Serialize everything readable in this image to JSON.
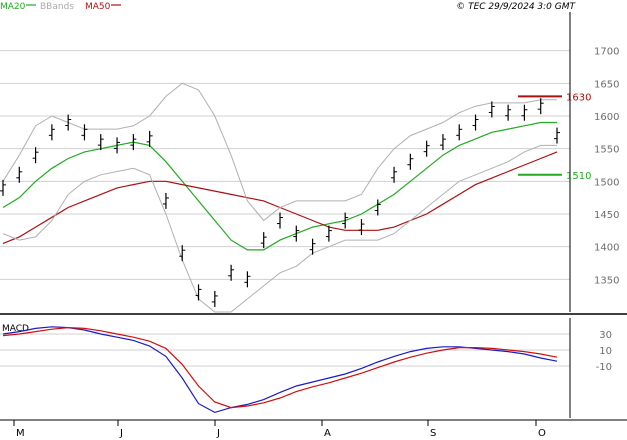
{
  "header": {
    "legend": [
      {
        "label": "MA20",
        "color": "#22aa22"
      },
      {
        "label": "BBands",
        "color": "#aaaaaa"
      },
      {
        "label": "MA50",
        "color": "#aa1111"
      }
    ],
    "copyright": "© TEC 29/9/2024 3:0 GMT"
  },
  "colors": {
    "grid": "#d0d0d0",
    "frame": "#000000",
    "ma20": "#22aa22",
    "ma50": "#aa1111",
    "bb": "#b0b0b0",
    "price": "#000000",
    "macd": "#1a1ac8",
    "signal": "#d01010",
    "tick_label": "#6d6d6d"
  },
  "chart_data": [
    {
      "type": "line",
      "title": "",
      "x": [
        "M",
        "J",
        "J",
        "A",
        "S",
        "O"
      ],
      "ylim": [
        1300,
        1750
      ],
      "y_ticks": [
        "1700",
        "1650",
        "1600",
        "1550",
        "1500",
        "1450",
        "1400",
        "1350"
      ],
      "series": [
        {
          "name": "MA20",
          "color": "#22aa22",
          "values": [
            1460,
            1475,
            1500,
            1520,
            1535,
            1545,
            1550,
            1555,
            1560,
            1555,
            1530,
            1500,
            1470,
            1440,
            1410,
            1395,
            1395,
            1410,
            1420,
            1430,
            1435,
            1440,
            1450,
            1465,
            1480,
            1500,
            1520,
            1540,
            1555,
            1565,
            1575,
            1580,
            1585,
            1590,
            1590
          ]
        },
        {
          "name": "MA50",
          "color": "#aa1111",
          "values": [
            1405,
            1415,
            1430,
            1445,
            1460,
            1470,
            1480,
            1490,
            1495,
            1500,
            1500,
            1495,
            1490,
            1485,
            1480,
            1475,
            1470,
            1460,
            1450,
            1440,
            1430,
            1425,
            1425,
            1425,
            1430,
            1440,
            1450,
            1465,
            1480,
            1495,
            1505,
            1515,
            1525,
            1535,
            1545
          ]
        },
        {
          "name": "BBands upper",
          "color": "#aaaaaa",
          "values": [
            1500,
            1540,
            1585,
            1600,
            1590,
            1580,
            1580,
            1580,
            1585,
            1600,
            1630,
            1650,
            1640,
            1600,
            1540,
            1470,
            1440,
            1460,
            1470,
            1470,
            1470,
            1470,
            1480,
            1520,
            1550,
            1570,
            1580,
            1590,
            1605,
            1615,
            1620,
            1620,
            1620,
            1625,
            1625
          ]
        },
        {
          "name": "BBands lower",
          "color": "#aaaaaa",
          "values": [
            1420,
            1410,
            1415,
            1440,
            1480,
            1500,
            1510,
            1515,
            1520,
            1510,
            1450,
            1380,
            1320,
            1300,
            1300,
            1320,
            1340,
            1360,
            1370,
            1390,
            1400,
            1410,
            1410,
            1410,
            1420,
            1440,
            1460,
            1480,
            1500,
            1510,
            1520,
            1530,
            1545,
            1555,
            1555
          ]
        },
        {
          "name": "Price",
          "color": "#000000",
          "values": [
            1490,
            1510,
            1540,
            1575,
            1590,
            1575,
            1560,
            1555,
            1560,
            1565,
            1470,
            1390,
            1330,
            1320,
            1360,
            1350,
            1410,
            1440,
            1420,
            1400,
            1420,
            1440,
            1430,
            1460,
            1510,
            1530,
            1550,
            1560,
            1575,
            1590,
            1610,
            1605,
            1605,
            1615,
            1570
          ]
        }
      ],
      "annotations": [
        {
          "label": "1630",
          "color": "#aa1111"
        },
        {
          "label": "1510",
          "color": "#22aa22"
        }
      ]
    },
    {
      "type": "line",
      "title": "MACD",
      "y_ticks": [
        "30",
        "10",
        "-10"
      ],
      "ylim": [
        -70,
        45
      ],
      "series": [
        {
          "name": "MACD",
          "color": "#1a1ac8",
          "values": [
            30,
            33,
            37,
            39,
            38,
            35,
            30,
            26,
            22,
            15,
            2,
            -25,
            -57,
            -68,
            -62,
            -58,
            -52,
            -43,
            -35,
            -30,
            -25,
            -20,
            -13,
            -5,
            2,
            8,
            12,
            14,
            14,
            12,
            10,
            8,
            5,
            0,
            -4
          ]
        },
        {
          "name": "Signal",
          "color": "#d01010",
          "values": [
            28,
            30,
            33,
            36,
            38,
            37,
            34,
            30,
            26,
            21,
            12,
            -8,
            -35,
            -55,
            -62,
            -60,
            -56,
            -50,
            -42,
            -36,
            -31,
            -25,
            -19,
            -12,
            -5,
            1,
            6,
            10,
            13,
            13,
            12,
            10,
            8,
            5,
            1
          ]
        }
      ]
    }
  ]
}
